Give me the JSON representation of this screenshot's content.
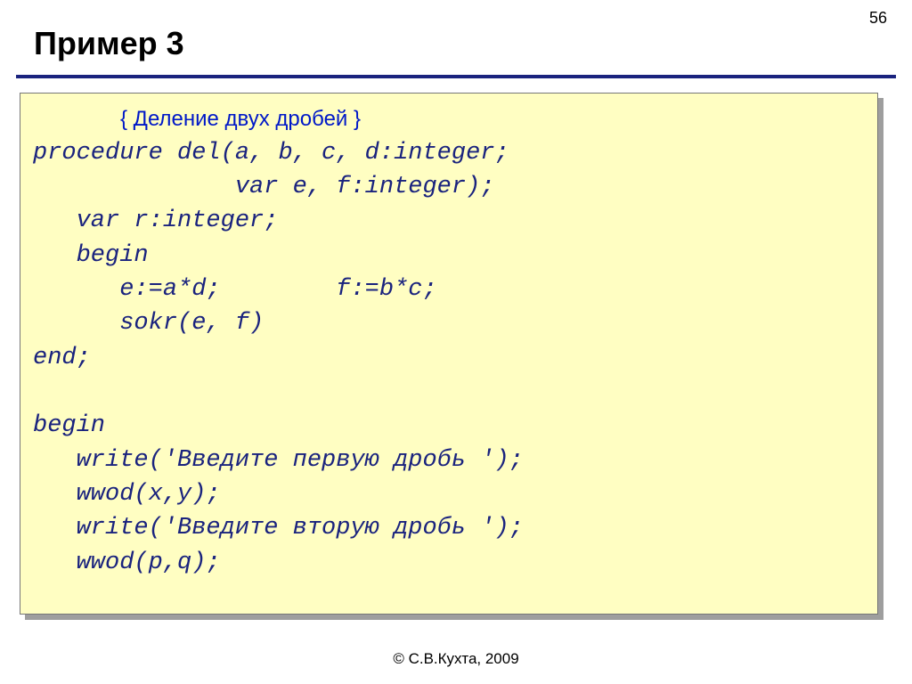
{
  "page_number": "56",
  "title": "Пример 3",
  "comment": "{ Деление двух дробей }",
  "code": "procedure del(a, b, c, d:integer;\n              var e, f:integer);\n   var r:integer;\n   begin\n      e:=a*d;        f:=b*c;\n      sokr(e, f)\nend;\n\nbegin\n   write('Введите первую дробь ');\n   wwod(x,y);\n   write('Введите вторую дробь ');\n   wwod(p,q);",
  "footer": "© С.В.Кухта, 2009"
}
